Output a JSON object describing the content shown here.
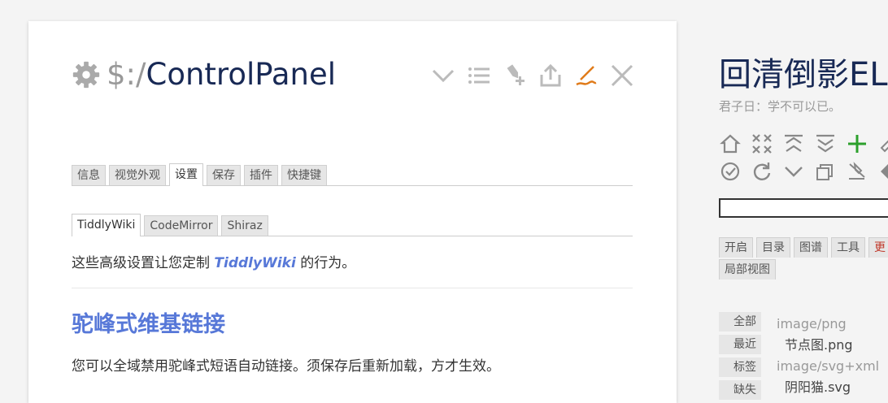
{
  "tiddler": {
    "title_prefix": "$:/",
    "title_main": "ControlPanel",
    "controls": [
      "chevron-down-icon",
      "list-icon",
      "tag-add-icon",
      "export-icon",
      "edit-pencil-icon",
      "close-icon"
    ],
    "main_tabs": [
      {
        "label": "信息",
        "active": false
      },
      {
        "label": "视觉外观",
        "active": false
      },
      {
        "label": "设置",
        "active": true
      },
      {
        "label": "保存",
        "active": false
      },
      {
        "label": "插件",
        "active": false
      },
      {
        "label": "快捷键",
        "active": false
      }
    ],
    "sub_tabs": [
      {
        "label": "TiddlyWiki",
        "active": true
      },
      {
        "label": "CodeMirror",
        "active": false
      },
      {
        "label": "Shiraz",
        "active": false
      }
    ],
    "intro_before": "这些高级设置让您定制 ",
    "intro_link": "TiddlyWiki",
    "intro_after": " 的行为。",
    "section_heading": "驼峰式维基链接",
    "section_text": "您可以全域禁用驼峰式短语自动链接。须保存后重新加载，方才生效。"
  },
  "sidebar": {
    "site_title": "回清倒影EL",
    "site_subtitle": "君子日：学不可以已。",
    "search_value": "",
    "tabs": [
      {
        "label": "开启"
      },
      {
        "label": "目录"
      },
      {
        "label": "图谱"
      },
      {
        "label": "工具"
      },
      {
        "label": "更"
      },
      {
        "label": "局部视图"
      }
    ],
    "more_tabs": [
      "全部",
      "最近",
      "标签",
      "缺失"
    ],
    "more_list": [
      {
        "type": "image/png",
        "items": [
          "节点图.png"
        ]
      },
      {
        "type": "image/svg+xml",
        "items": [
          "阴阳猫.svg"
        ]
      }
    ]
  },
  "colors": {
    "title": "#182955",
    "link": "#5778d8",
    "muted": "#999999",
    "pencil": "#e07b1a",
    "plus": "#2ca02c"
  }
}
